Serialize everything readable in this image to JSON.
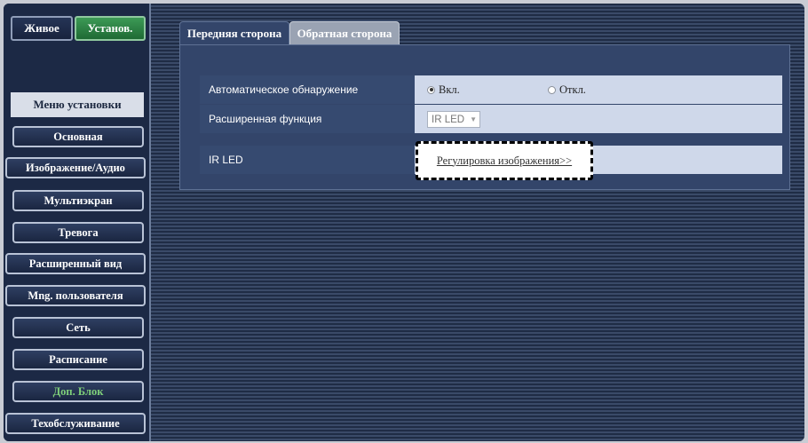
{
  "mode_buttons": {
    "live": "Живое",
    "setup": "Установ."
  },
  "menu": {
    "title": "Меню установки",
    "items": [
      {
        "label": "Основная"
      },
      {
        "label": "Изображение/Аудио"
      },
      {
        "label": "Мультиэкран"
      },
      {
        "label": "Тревога"
      },
      {
        "label": "Расширенный вид"
      },
      {
        "label": "Mng. пользователя"
      },
      {
        "label": "Сеть"
      },
      {
        "label": "Расписание"
      },
      {
        "label": "Доп. Блок"
      },
      {
        "label": "Техобслуживание"
      }
    ],
    "active": "Доп. Блок"
  },
  "tabs": [
    {
      "label": "Передняя сторона",
      "selected": true
    },
    {
      "label": "Обратная сторона",
      "selected": false
    }
  ],
  "settings": {
    "auto_detect": {
      "label": "Автоматическое обнаружение",
      "on": "Вкл.",
      "off": "Откл.",
      "selected": "on"
    },
    "advanced": {
      "label": "Расширенная функция",
      "value": "IR LED"
    },
    "ir_led": {
      "label": "IR LED",
      "link": "Регулировка изображения>>"
    }
  },
  "colors": {
    "setup_active": "#2f8a49",
    "active_menu_text": "#7fd07a",
    "panel": "#33456a",
    "value_cell": "#cfd8ea"
  },
  "icons": {
    "dropdown": "chevron-down-icon",
    "radio": "radio-icon"
  }
}
